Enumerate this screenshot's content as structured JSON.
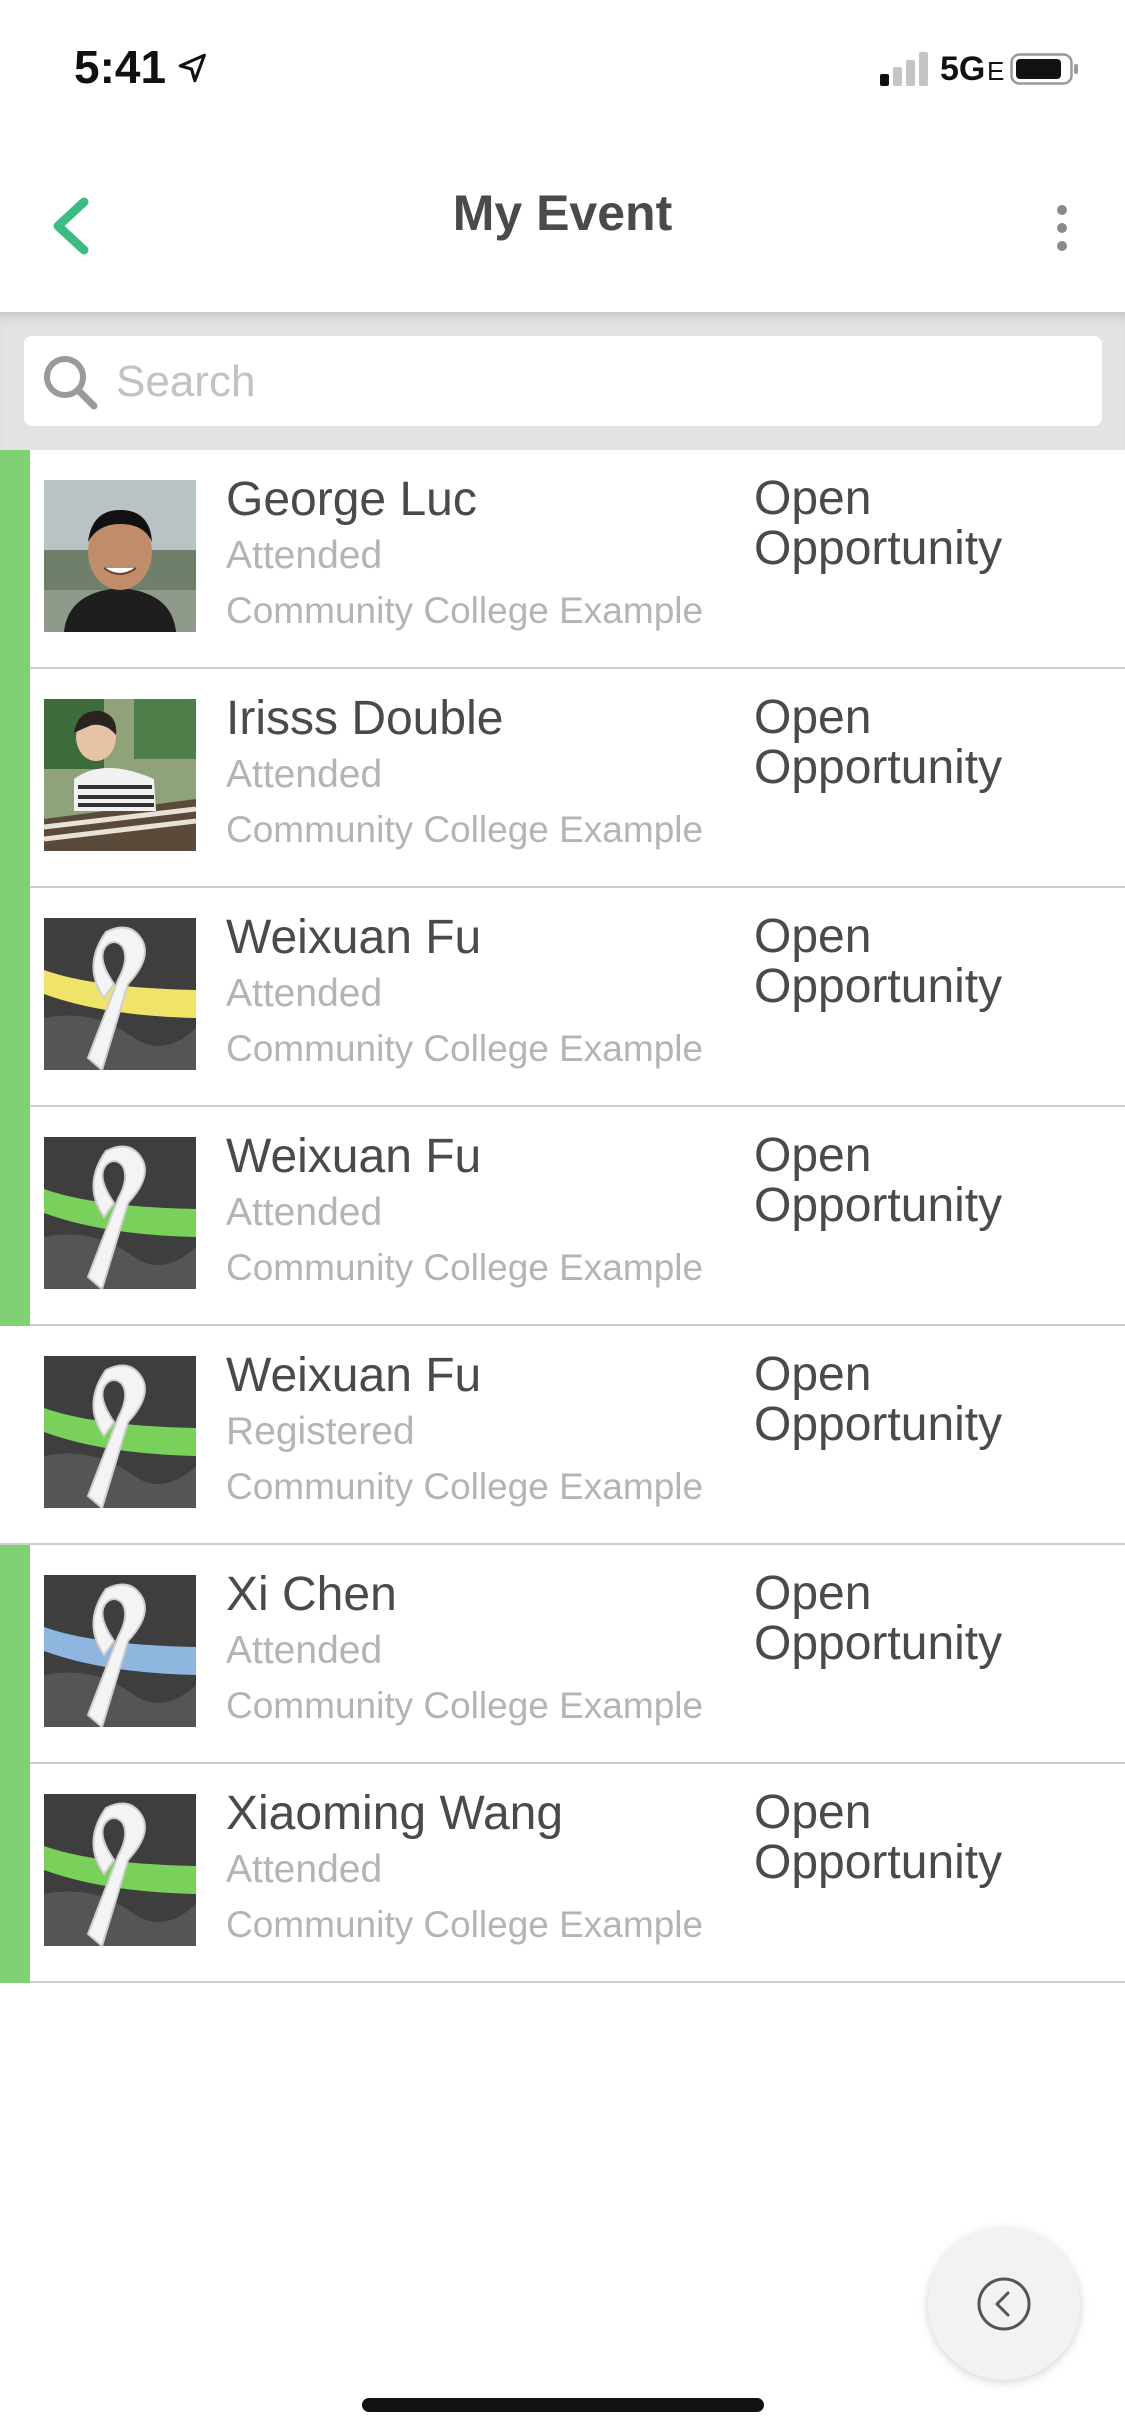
{
  "status_bar": {
    "time": "5:41",
    "network": "5G",
    "network_suffix": "E"
  },
  "header": {
    "title": "My Event"
  },
  "search": {
    "placeholder": "Search"
  },
  "list": [
    {
      "name": "George Luc",
      "status": "Attended",
      "org": "Community College Example",
      "opportunity": "Open Opportunity",
      "avatar": "photo-man",
      "ribbon_color": "",
      "indicator": true
    },
    {
      "name": "Irisss Double",
      "status": "Attended",
      "org": "Community College Example",
      "opportunity": "Open Opportunity",
      "avatar": "photo-woman",
      "ribbon_color": "",
      "indicator": true
    },
    {
      "name": "Weixuan Fu",
      "status": "Attended",
      "org": "Community College Example",
      "opportunity": "Open Opportunity",
      "avatar": "ribbon",
      "ribbon_color": "#f0e36a",
      "indicator": true
    },
    {
      "name": "Weixuan Fu",
      "status": "Attended",
      "org": "Community College Example",
      "opportunity": "Open Opportunity",
      "avatar": "ribbon",
      "ribbon_color": "#79d05a",
      "indicator": true
    },
    {
      "name": "Weixuan Fu",
      "status": "Registered",
      "org": "Community College Example",
      "opportunity": "Open Opportunity",
      "avatar": "ribbon",
      "ribbon_color": "#79d05a",
      "indicator": false
    },
    {
      "name": "Xi Chen",
      "status": "Attended",
      "org": "Community College Example",
      "opportunity": "Open Opportunity",
      "avatar": "ribbon",
      "ribbon_color": "#8fb6de",
      "indicator": true
    },
    {
      "name": "Xiaoming Wang",
      "status": "Attended",
      "org": "Community College Example",
      "opportunity": "Open Opportunity",
      "avatar": "ribbon",
      "ribbon_color": "#79d05a",
      "indicator": true
    }
  ],
  "colors": {
    "accent": "#3dbb84",
    "indicator": "#7fd174",
    "header_text": "#4a4a4a",
    "muted_text": "#b4b4b4"
  }
}
